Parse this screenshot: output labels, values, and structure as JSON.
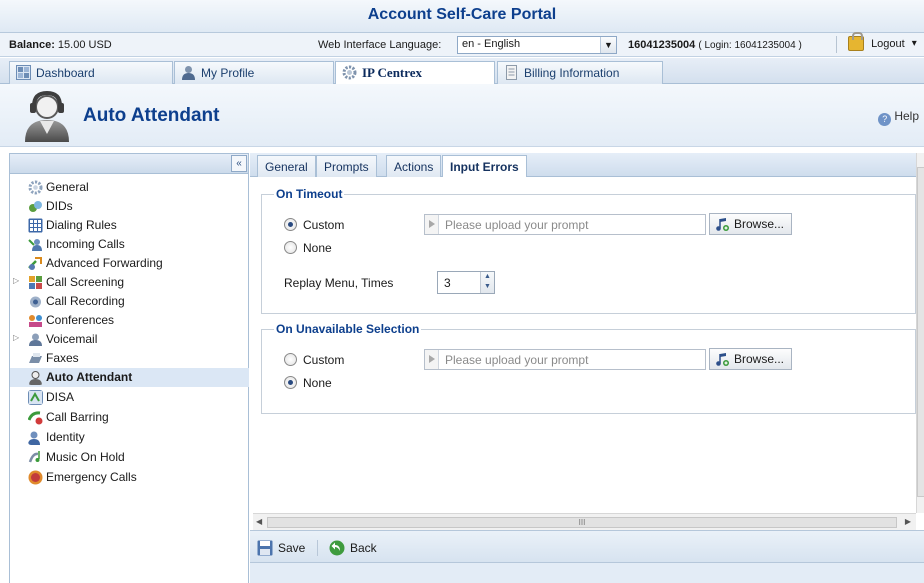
{
  "portal": {
    "title": "Account Self-Care Portal"
  },
  "infobar": {
    "balance_label": "Balance:",
    "balance_value": "15.00 USD",
    "language_label": "Web Interface Language:",
    "language_value": "en - English",
    "account_number": "16041235004",
    "account_login": "( Login: 16041235004 )",
    "logout_label": "Logout",
    "logout_arrow": "▾"
  },
  "top_tabs": [
    {
      "label": "Dashboard"
    },
    {
      "label": "My Profile"
    },
    {
      "label": "IP Centrex",
      "active": true
    },
    {
      "label": "Billing Information"
    }
  ],
  "page": {
    "title": "Auto Attendant",
    "help_label": "Help"
  },
  "sidebar": {
    "collapse_glyph": "«",
    "active_item": "Auto Attendant",
    "items": [
      {
        "label": "General",
        "icon": "gear-icon"
      },
      {
        "label": "DIDs",
        "icon": "dids-icon"
      },
      {
        "label": "Dialing Rules",
        "icon": "dialpad-icon"
      },
      {
        "label": "Incoming Calls",
        "icon": "incoming-calls-icon"
      },
      {
        "label": "Advanced Forwarding",
        "icon": "forwarding-icon"
      },
      {
        "label": "Call Screening",
        "icon": "call-screening-icon",
        "expandable": true
      },
      {
        "label": "Call Recording",
        "icon": "call-recording-icon"
      },
      {
        "label": "Conferences",
        "icon": "conferences-icon"
      },
      {
        "label": "Voicemail",
        "icon": "voicemail-icon",
        "expandable": true
      },
      {
        "label": "Faxes",
        "icon": "fax-icon"
      },
      {
        "label": "Auto Attendant",
        "icon": "auto-attendant-icon"
      },
      {
        "label": "DISA",
        "icon": "disa-icon"
      },
      {
        "label": "Call Barring",
        "icon": "call-barring-icon"
      },
      {
        "label": "Identity",
        "icon": "identity-icon"
      },
      {
        "label": "Music On Hold",
        "icon": "music-icon"
      },
      {
        "label": "Emergency Calls",
        "icon": "emergency-icon"
      }
    ]
  },
  "content_tabs": [
    {
      "label": "General"
    },
    {
      "label": "Prompts"
    },
    {
      "label": "Actions"
    },
    {
      "label": "Input Errors",
      "active": true
    }
  ],
  "on_timeout": {
    "legend": "On Timeout",
    "custom_label": "Custom",
    "none_label": "None",
    "selected": "Custom",
    "prompt_placeholder": "Please upload your prompt",
    "browse_label": "Browse...",
    "replay_label": "Replay Menu, Times",
    "replay_value": "3"
  },
  "on_unavailable": {
    "legend": "On Unavailable Selection",
    "custom_label": "Custom",
    "none_label": "None",
    "selected": "None",
    "prompt_placeholder": "Please upload your prompt",
    "browse_label": "Browse..."
  },
  "scrollbar": {
    "thumb_grip": "III"
  },
  "footer": {
    "save_label": "Save",
    "back_label": "Back"
  },
  "colors": {
    "title_blue": "#0d3f8d",
    "panel_bg": "#e3ecf6",
    "active_item_bg": "#dbe7f5"
  }
}
